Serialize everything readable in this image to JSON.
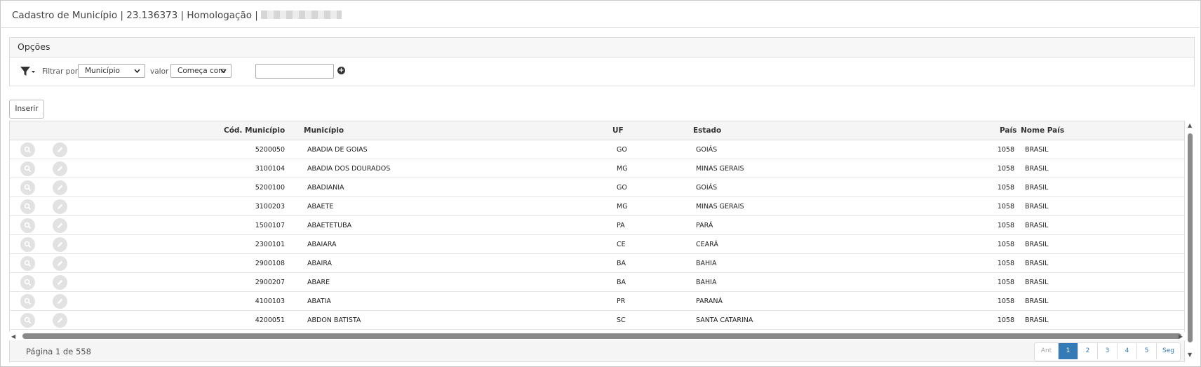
{
  "title": {
    "text": "Cadastro de Município | 23.136373 | Homologação |"
  },
  "options": {
    "title": "Opções",
    "filter_label": "Filtrar por",
    "filter_field": "Município",
    "value_label": "valor",
    "operator": "Começa com",
    "value_input": ""
  },
  "toolbar": {
    "insert_label": "Inserir"
  },
  "table": {
    "headers": {
      "code": "Cód. Município",
      "municipio": "Município",
      "uf": "UF",
      "estado": "Estado",
      "pais": "País",
      "nome_pais": "Nome País"
    },
    "rows": [
      {
        "code": "5200050",
        "municipio": "ABADIA DE GOIAS",
        "uf": "GO",
        "estado": "GOIÁS",
        "pais": "1058",
        "nome_pais": "BRASIL"
      },
      {
        "code": "3100104",
        "municipio": "ABADIA DOS DOURADOS",
        "uf": "MG",
        "estado": "MINAS GERAIS",
        "pais": "1058",
        "nome_pais": "BRASIL"
      },
      {
        "code": "5200100",
        "municipio": "ABADIANIA",
        "uf": "GO",
        "estado": "GOIÁS",
        "pais": "1058",
        "nome_pais": "BRASIL"
      },
      {
        "code": "3100203",
        "municipio": "ABAETE",
        "uf": "MG",
        "estado": "MINAS GERAIS",
        "pais": "1058",
        "nome_pais": "BRASIL"
      },
      {
        "code": "1500107",
        "municipio": "ABAETETUBA",
        "uf": "PA",
        "estado": "PARÁ",
        "pais": "1058",
        "nome_pais": "BRASIL"
      },
      {
        "code": "2300101",
        "municipio": "ABAIARA",
        "uf": "CE",
        "estado": "CEARÁ",
        "pais": "1058",
        "nome_pais": "BRASIL"
      },
      {
        "code": "2900108",
        "municipio": "ABAIRA",
        "uf": "BA",
        "estado": "BAHIA",
        "pais": "1058",
        "nome_pais": "BRASIL"
      },
      {
        "code": "2900207",
        "municipio": "ABARE",
        "uf": "BA",
        "estado": "BAHIA",
        "pais": "1058",
        "nome_pais": "BRASIL"
      },
      {
        "code": "4100103",
        "municipio": "ABATIA",
        "uf": "PR",
        "estado": "PARANÁ",
        "pais": "1058",
        "nome_pais": "BRASIL"
      },
      {
        "code": "4200051",
        "municipio": "ABDON BATISTA",
        "uf": "SC",
        "estado": "SANTA CATARINA",
        "pais": "1058",
        "nome_pais": "BRASIL"
      }
    ]
  },
  "footer": {
    "page_info": "Página 1 de 558",
    "prev": "Ant",
    "pages": [
      "1",
      "2",
      "3",
      "4",
      "5"
    ],
    "current_page": "1",
    "next": "Seg"
  },
  "icons": {
    "filter": "funnel-icon",
    "add": "plus-circle-icon",
    "view": "magnifier-icon",
    "edit": "pencil-icon"
  },
  "colors": {
    "accent": "#337ab7",
    "row_button": "#e2e2e2",
    "header_bg": "#f5f5f5"
  }
}
